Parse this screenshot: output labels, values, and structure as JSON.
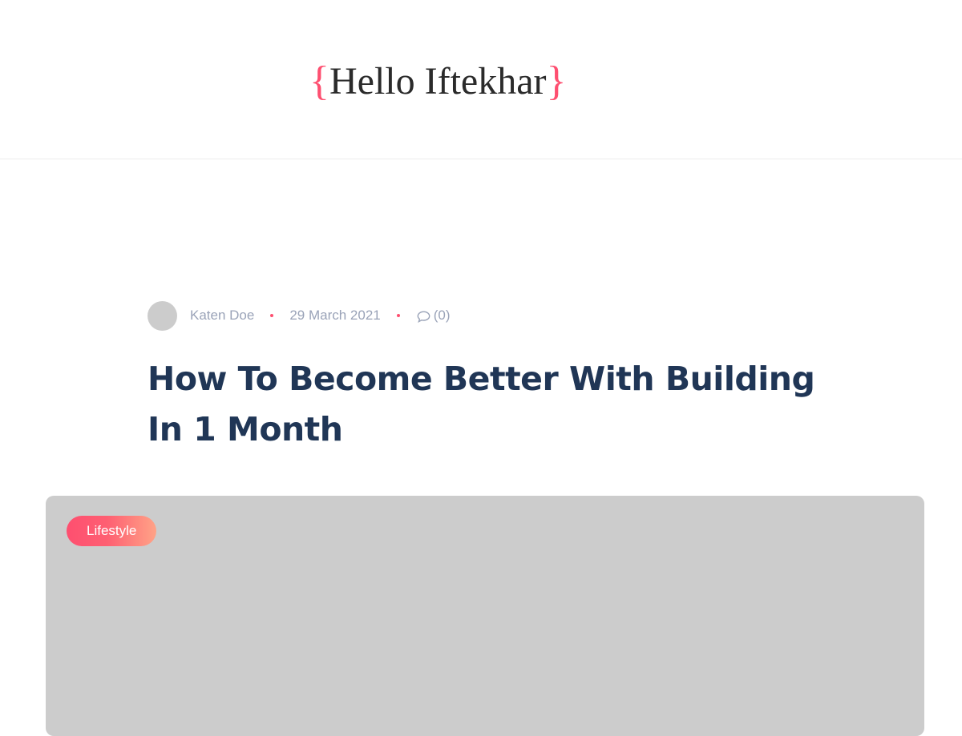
{
  "header": {
    "logo": {
      "open_brace": "{",
      "text": "Hello Iftekhar",
      "close_brace": "}"
    }
  },
  "post": {
    "meta": {
      "author": "Katen Doe",
      "date": "29 March 2021",
      "comments": "(0)"
    },
    "title": "How To Become Better With Building In 1 Month",
    "category": "Lifestyle"
  },
  "colors": {
    "accent": "#fe4f70",
    "accent_gradient_end": "#ffa387",
    "title": "#203656",
    "meta_text": "#9aa3b8",
    "placeholder": "#cccccc"
  },
  "icons": {
    "comments": "speech-bubble-icon"
  }
}
